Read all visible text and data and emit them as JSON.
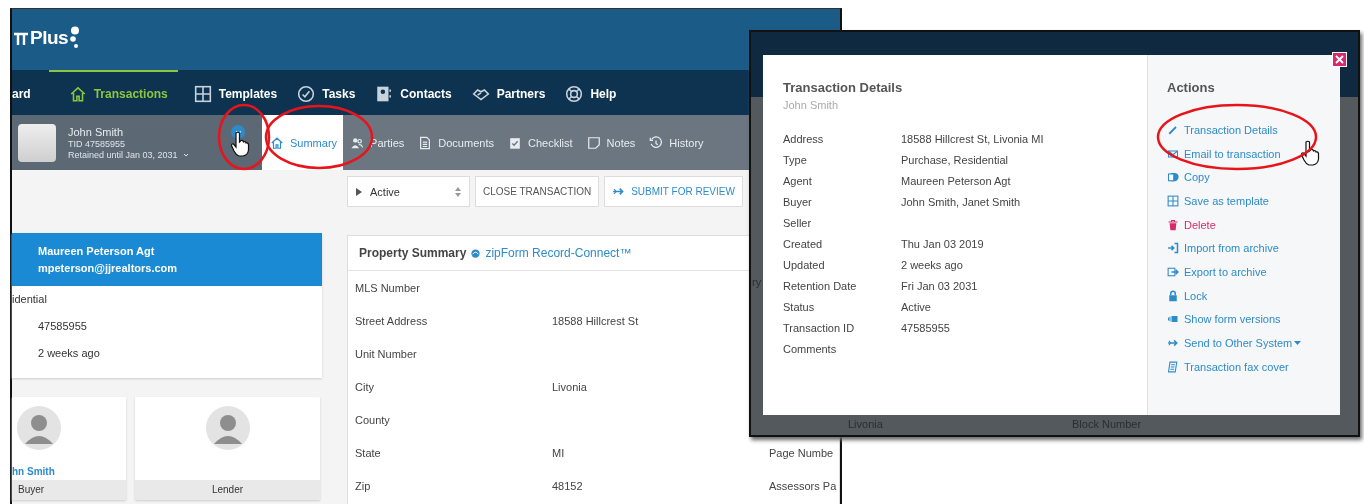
{
  "app": {
    "logo": "Plus",
    "nav": [
      {
        "label": "ard",
        "selected": false
      },
      {
        "label": "Transactions",
        "selected": true
      },
      {
        "label": "Templates",
        "selected": false
      },
      {
        "label": "Tasks",
        "selected": false
      },
      {
        "label": "Contacts",
        "selected": false
      },
      {
        "label": "Partners",
        "selected": false
      },
      {
        "label": "Help",
        "selected": false
      }
    ],
    "record": {
      "name": "John Smith",
      "tid": "TID 47585955",
      "retained": "Retained until Jan 03, 2031"
    },
    "tabs": [
      {
        "label": "Summary",
        "selected": true
      },
      {
        "label": "Parties",
        "selected": false
      },
      {
        "label": "Documents",
        "selected": false
      },
      {
        "label": "Checklist",
        "selected": false
      },
      {
        "label": "Notes",
        "selected": false
      },
      {
        "label": "History",
        "selected": false
      }
    ],
    "status": "Active",
    "toolbar_buttons": [
      "CLOSE TRANSACTION",
      "SUBMIT FOR REVIEW"
    ],
    "agent_card": {
      "name": "Maureen Peterson Agt",
      "email": "mpeterson@jjrealtors.com",
      "rows": [
        {
          "label": "idential"
        },
        {
          "value": "47585955"
        },
        {
          "value": "2 weeks ago"
        }
      ]
    },
    "parties": [
      {
        "name": "hn Smith",
        "role": "Buyer"
      },
      {
        "role": "Lender"
      }
    ],
    "property_summary": {
      "title": "Property Summary",
      "link": "zipForm Record-Connect™",
      "rows": [
        {
          "label": "MLS Number"
        },
        {
          "label": "Street Address",
          "value": "18588 Hillcrest St"
        },
        {
          "label": "Unit Number"
        },
        {
          "label": "City",
          "value": "Livonia"
        },
        {
          "label": "County"
        },
        {
          "label": "State",
          "value": "MI",
          "side_label": "Page Numbe"
        },
        {
          "label": "Zip",
          "value": "48152",
          "side_label": "Assessors Pa"
        }
      ]
    }
  },
  "overlay": {
    "backdrop": {
      "fragment": "ry",
      "city": "Livonia",
      "label": "Block Number"
    },
    "modal": {
      "title": "Transaction Details",
      "subtitle": "John Smith",
      "details": [
        {
          "label": "Address",
          "value": "18588 Hillcrest St, Livonia MI"
        },
        {
          "label": "Type",
          "value": "Purchase, Residential"
        },
        {
          "label": "Agent",
          "value": "Maureen Peterson Agt"
        },
        {
          "label": "Buyer",
          "value": "John Smith, Janet Smith"
        },
        {
          "label": "Seller"
        },
        {
          "label": "Created",
          "value": "Thu Jan 03 2019"
        },
        {
          "label": "Updated",
          "value": "2 weeks ago"
        },
        {
          "label": "Retention Date",
          "value": "Fri Jan 03 2031"
        },
        {
          "label": "Status",
          "value": "Active"
        },
        {
          "label": "Transaction ID",
          "value": "47585955"
        },
        {
          "label": "Comments"
        }
      ],
      "actions_title": "Actions",
      "actions": [
        {
          "label": "Transaction Details",
          "kind": "normal",
          "dropdown": false
        },
        {
          "label": "Email to transaction",
          "kind": "normal",
          "dropdown": false
        },
        {
          "label": "Copy",
          "kind": "normal",
          "dropdown": false
        },
        {
          "label": "Save as template",
          "kind": "normal",
          "dropdown": false
        },
        {
          "label": "Delete",
          "kind": "danger",
          "dropdown": false
        },
        {
          "label": "Import from archive",
          "kind": "normal",
          "dropdown": false
        },
        {
          "label": "Export to archive",
          "kind": "normal",
          "dropdown": false
        },
        {
          "label": "Lock",
          "kind": "normal",
          "dropdown": false
        },
        {
          "label": "Show form versions",
          "kind": "normal",
          "dropdown": false
        },
        {
          "label": "Send to Other System",
          "kind": "normal",
          "dropdown": true
        },
        {
          "label": "Transaction fax cover",
          "kind": "normal",
          "dropdown": false
        }
      ]
    }
  }
}
